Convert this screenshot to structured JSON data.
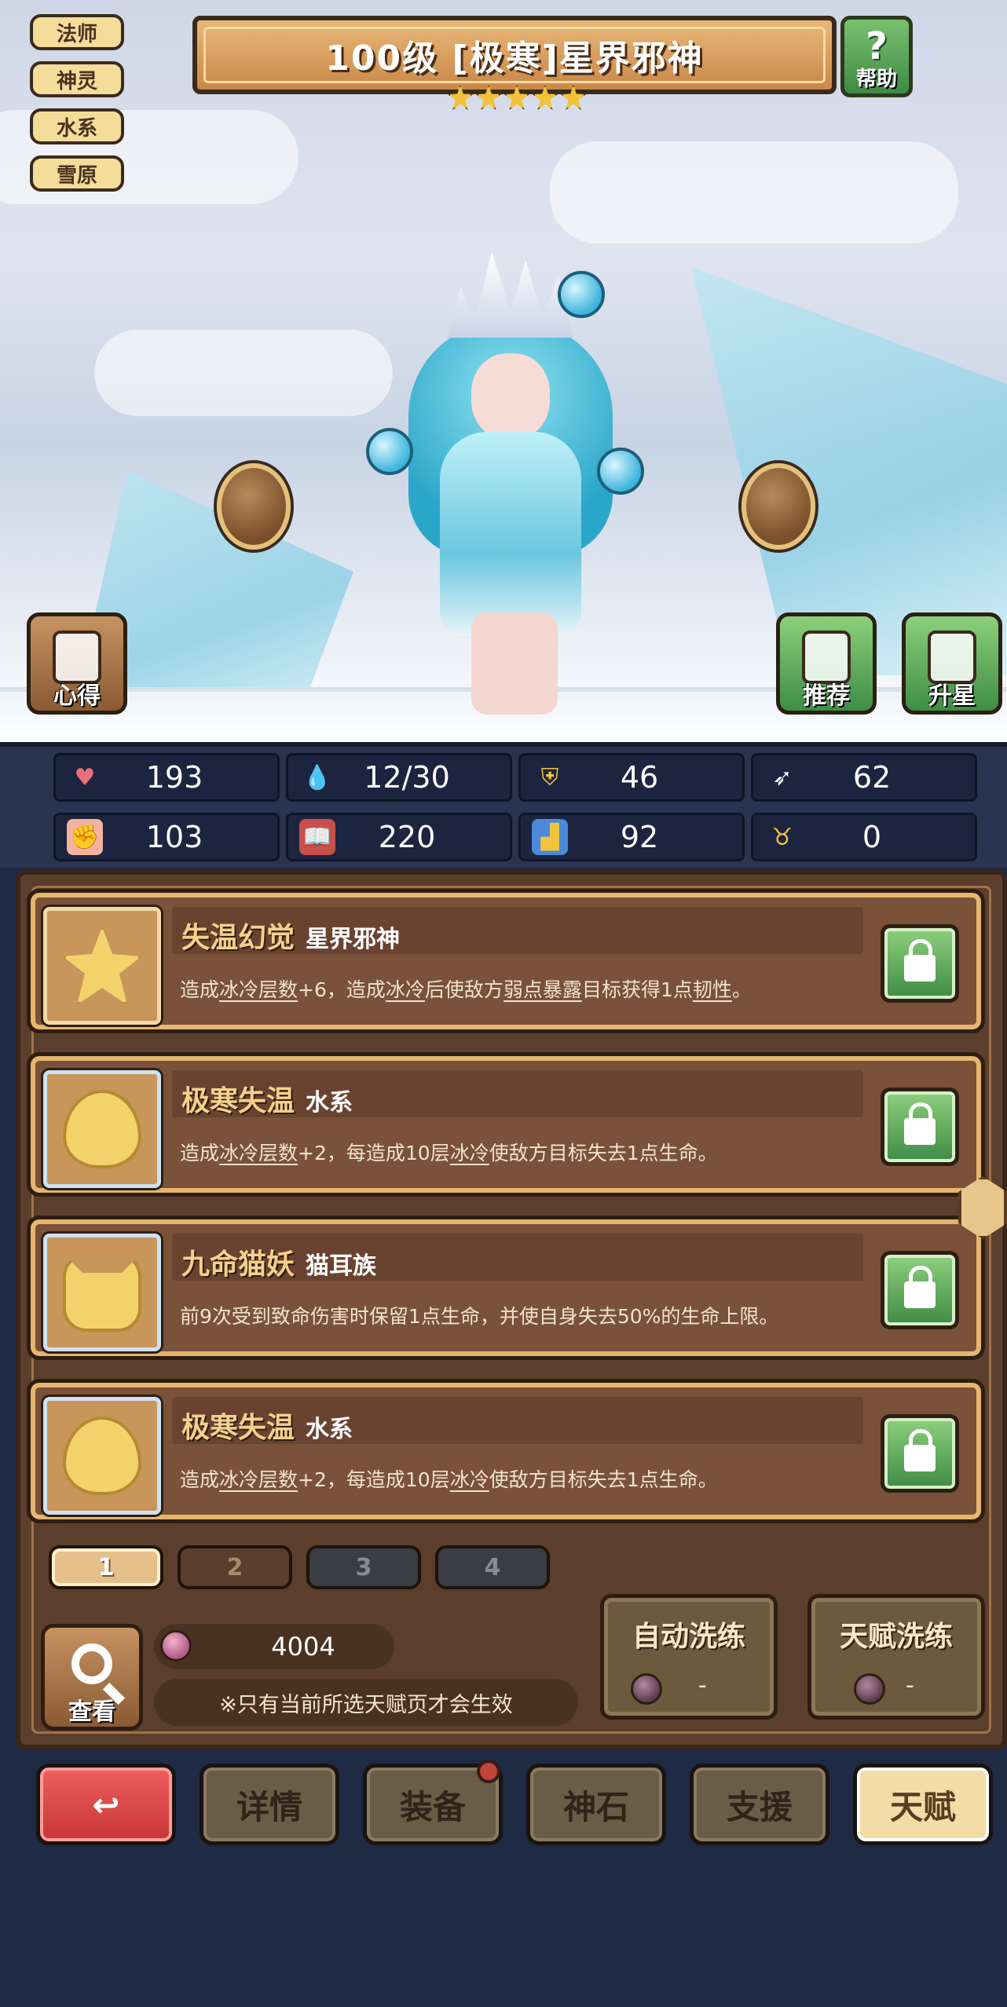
{
  "tags": [
    "法师",
    "神灵",
    "水系",
    "雪原"
  ],
  "title": "100级 [极寒]星界邪神",
  "star_count": 5,
  "help_label": "帮助",
  "side_buttons": {
    "insight": "心得",
    "recommend": "推荐",
    "star_up": "升星"
  },
  "stats": [
    {
      "icon": "heart-icon",
      "value": "193"
    },
    {
      "icon": "water-drop-icon",
      "value": "12/30"
    },
    {
      "icon": "shield-icon",
      "value": "46"
    },
    {
      "icon": "wing-icon",
      "value": "62"
    },
    {
      "icon": "fist-icon",
      "value": "103"
    },
    {
      "icon": "book-icon",
      "value": "220"
    },
    {
      "icon": "boot-icon",
      "value": "92"
    },
    {
      "icon": "horn-icon",
      "value": "0"
    }
  ],
  "talents": [
    {
      "name": "失温幻觉",
      "source": "星界邪神",
      "desc_parts": [
        "造成",
        "冰冷层数",
        "+6，造成",
        "冰冷",
        "后使敌方",
        "弱点暴露",
        "目标获得1点",
        "韧性",
        "。"
      ]
    },
    {
      "name": "极寒失温",
      "source": "水系",
      "desc_parts": [
        "造成",
        "冰冷层数",
        "+2，每造成10层",
        "冰冷",
        "使敌方目标失去1点生命。"
      ]
    },
    {
      "name": "九命猫妖",
      "source": "猫耳族",
      "desc": "前9次受到致命伤害时保留1点生命，并使自身失去50%的生命上限。"
    },
    {
      "name": "极寒失温",
      "source": "水系",
      "desc_parts": [
        "造成",
        "冰冷层数",
        "+2，每造成10层",
        "冰冷",
        "使敌方目标失去1点生命。"
      ]
    }
  ],
  "pages": [
    "1",
    "2",
    "3",
    "4"
  ],
  "look_label": "查看",
  "currency_value": "4004",
  "note": "※只有当前所选天赋页才会生效",
  "auto_wash": {
    "label": "自动洗练",
    "value": "-"
  },
  "talent_wash": {
    "label": "天赋洗练",
    "value": "-"
  },
  "nav": {
    "details": "详情",
    "equipment": "装备",
    "godstone": "神石",
    "support": "支援",
    "talent": "天赋"
  },
  "colors": {
    "panel": "#5b3f2c",
    "gold": "#f6d08c",
    "green": "#3f8a45",
    "back_red": "#c53535"
  }
}
